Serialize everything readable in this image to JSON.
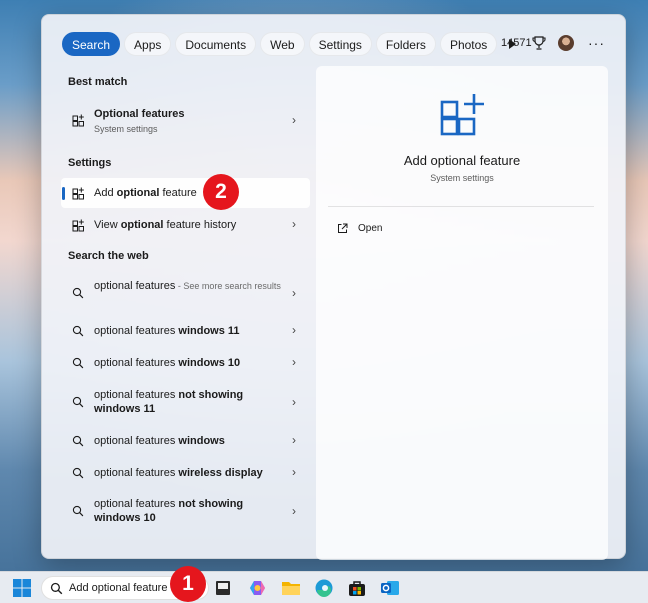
{
  "filters": {
    "items": [
      {
        "label": "Search",
        "active": true
      },
      {
        "label": "Apps",
        "active": false
      },
      {
        "label": "Documents",
        "active": false
      },
      {
        "label": "Web",
        "active": false
      },
      {
        "label": "Settings",
        "active": false
      },
      {
        "label": "Folders",
        "active": false
      },
      {
        "label": "Photos",
        "active": false
      }
    ],
    "more_icon": "play-icon"
  },
  "account": {
    "points": "14571",
    "points_icon": "trophy-icon",
    "avatar_icon": "avatar",
    "overflow_icon": "more-icon"
  },
  "left": {
    "best_match_heading": "Best match",
    "best_match": {
      "title": "Optional features",
      "subtitle": "System settings",
      "icon": "settings-grid-icon"
    },
    "settings_heading": "Settings",
    "settings_items": [
      {
        "pre": "Add ",
        "bold": "optional",
        "post": " feature",
        "icon": "settings-grid-icon"
      },
      {
        "pre": "View ",
        "bold": "optional",
        "post": " feature history",
        "icon": "settings-grid-icon"
      }
    ],
    "web_heading": "Search the web",
    "web_items": [
      {
        "pre": "optional features",
        "bold": "",
        "suffix": " - See more search results"
      },
      {
        "pre": "optional features ",
        "bold": "windows 11",
        "suffix": ""
      },
      {
        "pre": "optional features ",
        "bold": "windows 10",
        "suffix": ""
      },
      {
        "pre": "optional features ",
        "bold": "not showing windows 11",
        "suffix": ""
      },
      {
        "pre": "optional features ",
        "bold": "windows",
        "suffix": ""
      },
      {
        "pre": "optional features ",
        "bold": "wireless display",
        "suffix": ""
      },
      {
        "pre": "optional features ",
        "bold": "not showing windows 10",
        "suffix": ""
      }
    ]
  },
  "detail": {
    "title": "Add optional feature",
    "subtitle": "System settings",
    "action_label": "Open",
    "accent": "#1a67c3"
  },
  "taskbar": {
    "search_value": "Add optional feature",
    "apps": [
      "start-icon",
      "search-icon",
      "task-view-icon",
      "copilot-icon",
      "file-explorer-icon",
      "edge-icon",
      "store-icon",
      "outlook-icon"
    ]
  },
  "annotations": {
    "step1": "1",
    "step2": "2",
    "badge_color": "#e5161d"
  }
}
